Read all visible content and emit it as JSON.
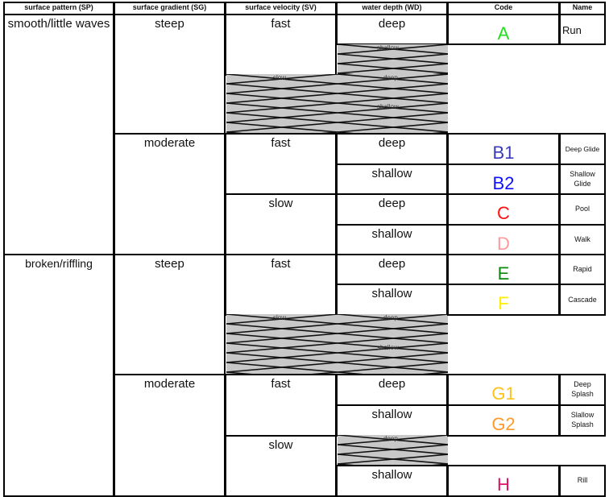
{
  "headers": {
    "sp": "surface pattern (SP)",
    "sg": "surface gradient (SG)",
    "sv": "surface velocity (SV)",
    "wd": "water depth (WD)",
    "code": "Code",
    "name": "Name"
  },
  "sp": [
    "smooth/little waves",
    "broken/riffling"
  ],
  "sg": [
    "steep",
    "moderate",
    "steep",
    "moderate"
  ],
  "sv": {
    "r1": "fast",
    "r2": "fast",
    "r3": "slow",
    "r4": "fast",
    "r5": "fast",
    "r6": "slow"
  },
  "wd": {
    "a": "deep",
    "b1": "deep",
    "b2": "shallow",
    "c": "deep",
    "d": "shallow",
    "e": "deep",
    "f": "shallow",
    "g1": "deep",
    "g2": "shallow",
    "h": "shallow"
  },
  "hatch_labels": {
    "h1_shallow": "shallow",
    "h1_slow": "slow",
    "h1_deep": "deep",
    "h1_shallow2": "shallow",
    "h2_slow": "slow",
    "h2_deep": "deep",
    "h2_shallow": "shallow",
    "h3_deep": "deep"
  },
  "codes": [
    {
      "code": "A",
      "name": "Run",
      "color": "#22e01e"
    },
    {
      "code": "B1",
      "name": "Deep Glide",
      "color": "#3a3ab8"
    },
    {
      "code": "B2",
      "name": "Shallow Glide",
      "color": "#1010ff"
    },
    {
      "code": "C",
      "name": "Pool",
      "color": "#ff1010"
    },
    {
      "code": "D",
      "name": "Walk",
      "color": "#ff9a9a"
    },
    {
      "code": "E",
      "name": "Rapid",
      "color": "#0a8a0a"
    },
    {
      "code": "F",
      "name": "Cascade",
      "color": "#ffee00"
    },
    {
      "code": "G1",
      "name": "Deep Splash",
      "color": "#ffc21a"
    },
    {
      "code": "G2",
      "name": "Slallow Splash",
      "color": "#ff9a2a"
    },
    {
      "code": "H",
      "name": "Rill",
      "color": "#e0106a"
    }
  ]
}
